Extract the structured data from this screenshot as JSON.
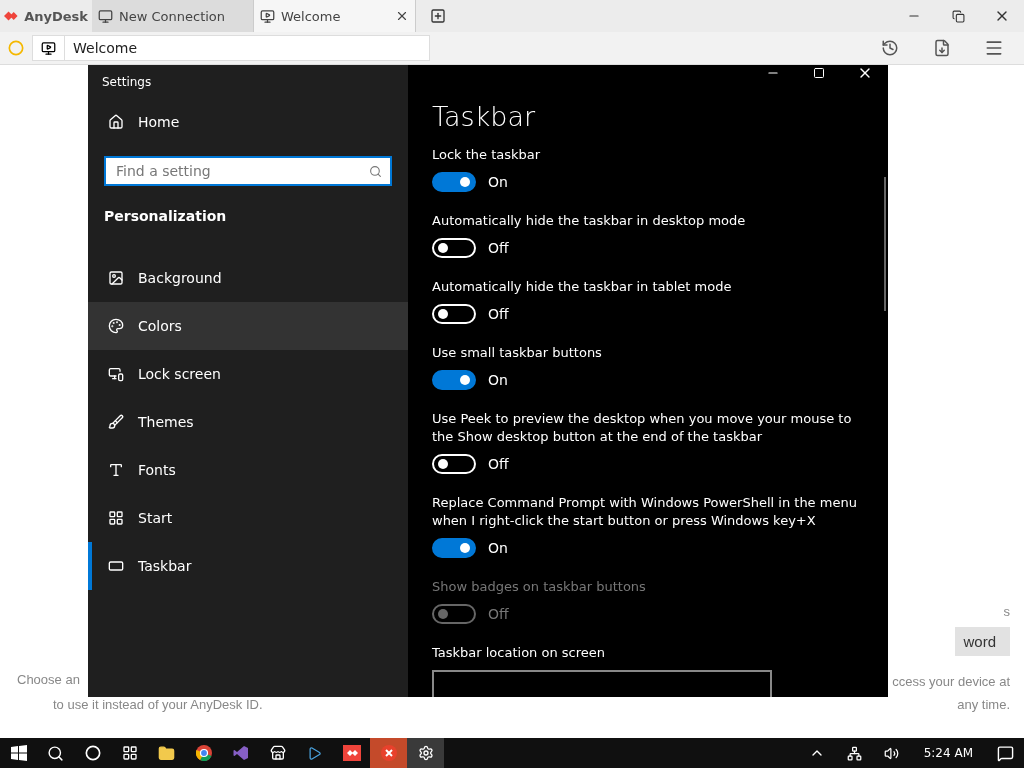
{
  "app": {
    "name": "AnyDesk",
    "tabs": [
      {
        "label": "New Connection",
        "selected": false
      },
      {
        "label": "Welcome",
        "selected": true
      }
    ],
    "address": {
      "value": "Welcome"
    }
  },
  "background": {
    "left_lines": [
      "Choose an",
      "to use it instead of your AnyDesk ID."
    ],
    "right_fragment": "s",
    "right_button": "word",
    "right_lines": [
      "ccess your device at",
      "any time."
    ]
  },
  "settings": {
    "title": "Settings",
    "home": "Home",
    "search": {
      "placeholder": "Find a setting"
    },
    "section": "Personalization",
    "nav": [
      {
        "label": "Background",
        "selected": false,
        "hovered": false
      },
      {
        "label": "Colors",
        "selected": false,
        "hovered": true
      },
      {
        "label": "Lock screen",
        "selected": false,
        "hovered": false
      },
      {
        "label": "Themes",
        "selected": false,
        "hovered": false
      },
      {
        "label": "Fonts",
        "selected": false,
        "hovered": false
      },
      {
        "label": "Start",
        "selected": false,
        "hovered": false
      },
      {
        "label": "Taskbar",
        "selected": true,
        "hovered": false
      }
    ],
    "page_title": "Taskbar",
    "options": [
      {
        "kind": "toggle",
        "label": "Lock the taskbar",
        "on": true,
        "disabled": false,
        "state_text": "On"
      },
      {
        "kind": "toggle",
        "label": "Automatically hide the taskbar in desktop mode",
        "on": false,
        "disabled": false,
        "state_text": "Off"
      },
      {
        "kind": "toggle",
        "label": "Automatically hide the taskbar in tablet mode",
        "on": false,
        "disabled": false,
        "state_text": "Off"
      },
      {
        "kind": "toggle",
        "label": "Use small taskbar buttons",
        "on": true,
        "disabled": false,
        "state_text": "On"
      },
      {
        "kind": "toggle",
        "label": "Use Peek to preview the desktop when you move your mouse to the Show desktop button at the end of the taskbar",
        "on": false,
        "disabled": false,
        "state_text": "Off"
      },
      {
        "kind": "toggle",
        "label": "Replace Command Prompt with Windows PowerShell in the menu when I right-click the start button or press Windows key+X",
        "on": true,
        "disabled": false,
        "state_text": "On"
      },
      {
        "kind": "toggle",
        "label": "Show badges on taskbar buttons",
        "on": false,
        "disabled": true,
        "state_text": "Off"
      },
      {
        "kind": "dropdown",
        "label": "Taskbar location on screen"
      }
    ]
  },
  "taskbar": {
    "time": "5:24 AM"
  }
}
